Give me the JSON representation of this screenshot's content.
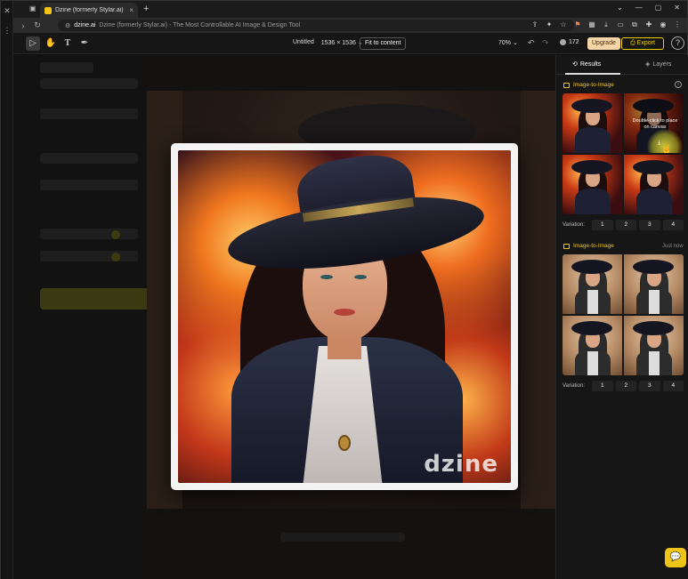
{
  "browser": {
    "tab_title": "Dzine (formerly Stylar.ai) - The",
    "new_tab_label": "+",
    "url_host": "dzine.ai",
    "url_rest": "Dzine (formerly Stylar.ai) - The Most Controllable AI Image & Design Tool"
  },
  "toolbar": {
    "doc_name": "Untitled",
    "canvas_size": "1536 × 1536",
    "fit_label": "Fit to content",
    "zoom": "70%",
    "credits": "172",
    "upgrade_label": "Upgrade",
    "export_label": "Export",
    "help_label": "?"
  },
  "right_panel": {
    "tabs": [
      {
        "label": "Results"
      },
      {
        "label": "Layers"
      }
    ],
    "sections": [
      {
        "title": "Image-to-Image",
        "timestamp": "",
        "hover_hint": "Double-click to place on canvas",
        "variation_label": "Variation:",
        "variations": [
          "1",
          "2",
          "3",
          "4"
        ]
      },
      {
        "title": "Image-to-Image",
        "timestamp": "Just now",
        "variation_label": "Variation:",
        "variations": [
          "1",
          "2",
          "3",
          "4"
        ]
      }
    ]
  },
  "preview": {
    "watermark": "dzine"
  },
  "colors": {
    "accent": "#f0c419",
    "upgrade_bg": "#f3d5a8",
    "panel_bg": "#161616"
  },
  "icons": {
    "select_tool": "cursor-arrow-icon",
    "hand_tool": "hand-icon",
    "text_tool": "text-icon",
    "pen_tool": "pen-icon",
    "undo": "undo-icon",
    "redo": "redo-icon",
    "chat": "chat-icon"
  }
}
